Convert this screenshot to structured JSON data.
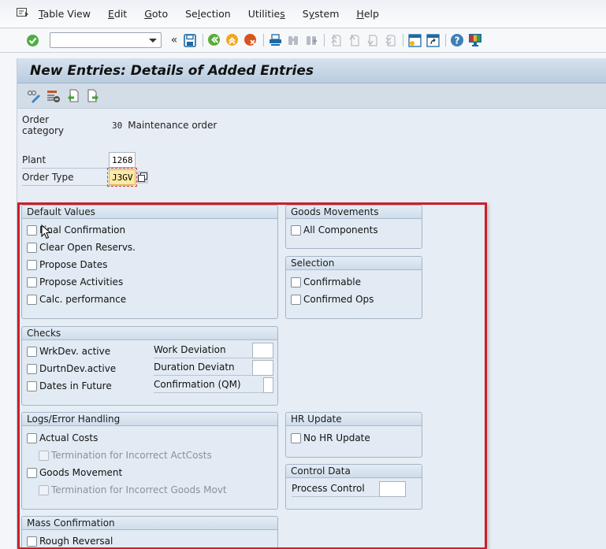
{
  "menubar": {
    "items": [
      {
        "label": "Table View",
        "mnemonic": "T"
      },
      {
        "label": "Edit",
        "mnemonic": "E"
      },
      {
        "label": "Goto",
        "mnemonic": "G"
      },
      {
        "label": "Selection",
        "mnemonic": "l"
      },
      {
        "label": "Utilities",
        "mnemonic": "s"
      },
      {
        "label": "System",
        "mnemonic": "y"
      },
      {
        "label": "Help",
        "mnemonic": "H"
      }
    ]
  },
  "toolbar": {
    "command_field_value": "",
    "icons": [
      "enter-checkmark-icon",
      "command-dropdown-icon",
      "collapse-chevrons-icon",
      "save-icon",
      "back-icon",
      "exit-icon",
      "cancel-icon",
      "print-icon",
      "find-icon",
      "find-next-icon",
      "first-page-icon",
      "previous-page-icon",
      "next-page-icon",
      "last-page-icon",
      "create-session-icon",
      "generate-shortcut-icon",
      "help-icon",
      "customize-layout-icon"
    ]
  },
  "page": {
    "title": "New Entries: Details of Added Entries",
    "app_toolbar_icons": [
      "display-change-icon",
      "delete-row-icon",
      "previous-entry-icon",
      "next-entry-icon"
    ]
  },
  "header_fields": {
    "order_category": {
      "label": "Order category",
      "code": "30",
      "text": "Maintenance order"
    },
    "plant": {
      "label": "Plant",
      "value": "1268"
    },
    "order_type": {
      "label": "Order Type",
      "value": "J3GV"
    }
  },
  "groups": {
    "default_values": {
      "title": "Default Values",
      "checkboxes": [
        {
          "label": "Final Confirmation",
          "checked": false
        },
        {
          "label": "Clear Open Reservs.",
          "checked": false
        },
        {
          "label": "Propose Dates",
          "checked": false
        },
        {
          "label": "Propose Activities",
          "checked": false
        },
        {
          "label": "Calc. performance",
          "checked": false
        }
      ]
    },
    "goods_movements": {
      "title": "Goods Movements",
      "checkboxes": [
        {
          "label": "All Components",
          "checked": false
        }
      ]
    },
    "selection": {
      "title": "Selection",
      "checkboxes": [
        {
          "label": "Confirmable",
          "checked": false
        },
        {
          "label": "Confirmed Ops",
          "checked": false
        }
      ]
    },
    "checks": {
      "title": "Checks",
      "checkboxes": [
        {
          "label": "WrkDev. active",
          "checked": false
        },
        {
          "label": "DurtnDev.active",
          "checked": false
        },
        {
          "label": "Dates in Future",
          "checked": false
        }
      ],
      "fields": [
        {
          "label": "Work Deviation",
          "value": ""
        },
        {
          "label": "Duration Deviatn",
          "value": ""
        },
        {
          "label": "Confirmation (QM)",
          "value": ""
        }
      ]
    },
    "logs": {
      "title": "Logs/Error Handling",
      "checkboxes": [
        {
          "label": "Actual Costs",
          "checked": false,
          "disabled": false
        },
        {
          "label": "Termination for Incorrect ActCosts",
          "checked": false,
          "disabled": true
        },
        {
          "label": "Goods Movement",
          "checked": false,
          "disabled": false
        },
        {
          "label": "Termination for Incorrect Goods Movt",
          "checked": false,
          "disabled": true
        }
      ]
    },
    "hr_update": {
      "title": "HR Update",
      "checkboxes": [
        {
          "label": "No HR Update",
          "checked": false
        }
      ]
    },
    "control_data": {
      "title": "Control Data",
      "fields": [
        {
          "label": "Process Control",
          "value": ""
        }
      ]
    },
    "mass_confirmation": {
      "title": "Mass Confirmation",
      "checkboxes": [
        {
          "label": "Rough Reversal",
          "checked": false
        }
      ]
    }
  },
  "colors": {
    "highlight_border": "#c8202c",
    "required_field_bg": "#fbe9a6",
    "content_bg": "#e6edf4",
    "title_bar": "#c3d3e4"
  }
}
